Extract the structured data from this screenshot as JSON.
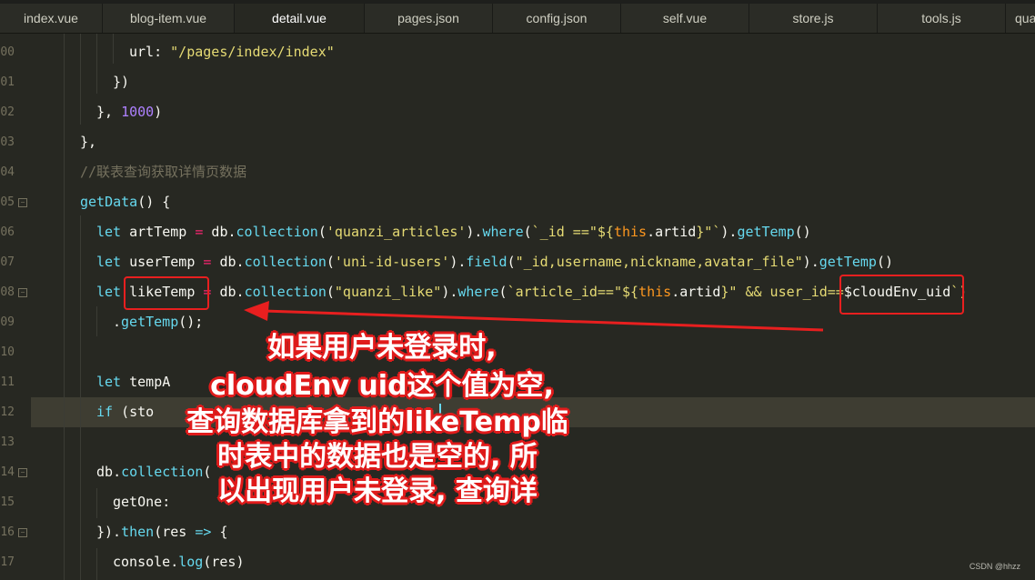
{
  "tabs": [
    {
      "label": "index.vue",
      "active": false
    },
    {
      "label": "blog-item.vue",
      "active": false
    },
    {
      "label": "detail.vue",
      "active": true
    },
    {
      "label": "pages.json",
      "active": false
    },
    {
      "label": "config.json",
      "active": false
    },
    {
      "label": "self.vue",
      "active": false
    },
    {
      "label": "store.js",
      "active": false
    },
    {
      "label": "tools.js",
      "active": false
    },
    {
      "label": "qua",
      "active": false
    }
  ],
  "gutter": [
    "00",
    "01",
    "02",
    "03",
    "04",
    "05",
    "06",
    "07",
    "08",
    "09",
    "10",
    "11",
    "12",
    "13",
    "14",
    "15",
    "16",
    "17"
  ],
  "code": {
    "l00": {
      "a": "url: ",
      "b": "\"/pages/index/index\""
    },
    "l01": {
      "a": "})"
    },
    "l02": {
      "a": "}, ",
      "b": "1000",
      "c": ")"
    },
    "l03": {
      "a": "},"
    },
    "l04": {
      "a": "//联表查询获取详情页数据"
    },
    "l05": {
      "a": "getData",
      "b": "() {"
    },
    "l06": {
      "a": "let",
      "b": " artTemp ",
      "c": "=",
      "d": " db",
      "e": ".",
      "f": "collection",
      "g": "(",
      "h": "'quanzi_articles'",
      "i": ").",
      "j": "where",
      "k": "(",
      "l": "`_id ==\"${",
      "m": "this",
      "n": ".",
      "o": "artid",
      "p": "}\"`",
      "q": ").",
      "r": "getTemp",
      "s": "()"
    },
    "l07": {
      "a": "let",
      "b": " userTemp ",
      "c": "=",
      "d": " db",
      "e": ".",
      "f": "collection",
      "g": "(",
      "h": "'uni-id-users'",
      "i": ").",
      "j": "field",
      "k": "(",
      "l": "\"_id,username,nickname,avatar_file\"",
      "m": ").",
      "n": "getTemp",
      "o": "()"
    },
    "l08": {
      "a": "let",
      "b": " likeTemp ",
      "c": "=",
      "d": " db",
      "e": ".",
      "f": "collection",
      "g": "(",
      "h": "\"quanzi_like\"",
      "i": ").",
      "j": "where",
      "k": "(",
      "l": "`article_id==\"${",
      "m": "this",
      "n": ".",
      "o": "artid",
      "p": "}\" && user_id==",
      "q": "$cloudEnv_uid",
      "r": "`)"
    },
    "l09": {
      "a": ".",
      "b": "getTemp",
      "c": "();"
    },
    "l11": {
      "a": "let",
      "b": " tempA"
    },
    "l12": {
      "a": "if",
      "b": " (sto"
    },
    "l14": {
      "a": "db",
      "b": ".",
      "c": "collection",
      "d": "("
    },
    "l15": {
      "a": "getOne",
      "b": ": "
    },
    "l16": {
      "a": "}).",
      "b": "then",
      "c": "(res ",
      "d": "=>",
      "e": " {"
    },
    "l17": {
      "a": "console",
      "b": ".",
      "c": "log",
      "d": "(res)"
    }
  },
  "annotation": {
    "line1": "如果用户未登录时,",
    "line2": "cloudEnv uid这个值为空,",
    "line3": "查询数据库拿到的likeTemp临",
    "line4": "时表中的数据也是空的, 所",
    "line5": "以出现用户未登录, 查询详"
  },
  "colors": {
    "annotation_red": "#e01b1b",
    "arrow_red": "#e81f1f"
  },
  "watermark": "CSDN @hhzz"
}
